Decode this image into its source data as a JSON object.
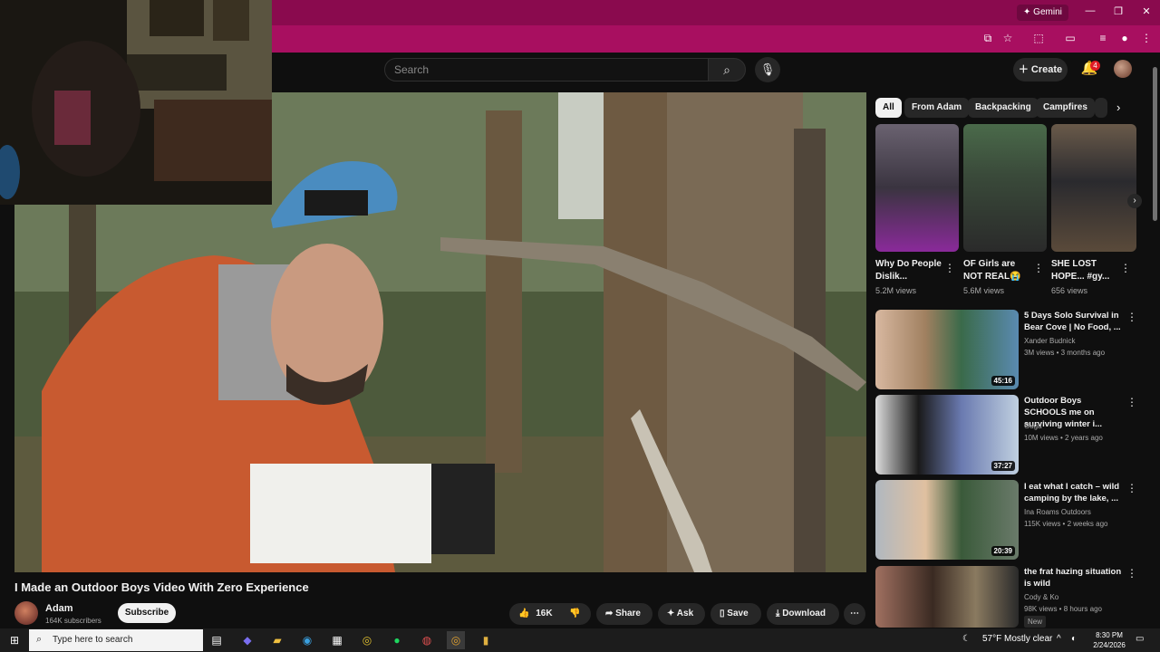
{
  "browser": {
    "gemini_label": "Gemini",
    "win_controls": [
      "—",
      "❐",
      "✕"
    ]
  },
  "youtube": {
    "search_placeholder": "Search",
    "create_label": "Create",
    "notification_count": "4"
  },
  "video": {
    "title": "I Made an Outdoor Boys Video With Zero Experience",
    "channel": "Adam",
    "subscribers": "164K subscribers",
    "subscribe_label": "Subscribe",
    "like_count": "16K",
    "share_label": "Share",
    "ask_label": "Ask",
    "save_label": "Save",
    "download_label": "Download"
  },
  "chips": [
    "All",
    "From Adam",
    "Backpacking",
    "Campfires"
  ],
  "shorts": [
    {
      "title": "Why Do People Dislik...",
      "views": "5.2M views"
    },
    {
      "title": "OF Girls are NOT REAL😭",
      "views": "5.6M views"
    },
    {
      "title": "SHE LOST HOPE... #gy...",
      "views": "656 views"
    }
  ],
  "recommended": [
    {
      "title": "5 Days Solo Survival in Bear Cove | No Food, ...",
      "channel": "Xander Budnick",
      "stats": "3M views • 3 months ago",
      "duration": "45:16",
      "badge": ""
    },
    {
      "title": "Outdoor Boys SCHOOLS me on surviving winter i...",
      "channel": "Guga",
      "stats": "10M views • 2 years ago",
      "duration": "37:27",
      "badge": ""
    },
    {
      "title": "I eat what I catch – wild camping by the lake, ...",
      "channel": "Ina Roams Outdoors",
      "stats": "115K views • 2 weeks ago",
      "duration": "20:39",
      "badge": ""
    },
    {
      "title": "the frat hazing situation is wild",
      "channel": "Cody & Ko",
      "stats": "98K views • 8 hours ago",
      "duration": "",
      "badge": "New"
    }
  ],
  "taskbar": {
    "search_placeholder": "Type here to search",
    "weather": "57°F  Mostly clear",
    "time": "8:30 PM",
    "date": "2/24/2026"
  },
  "colors": {
    "chrome_titlebar": "#8a0a4e",
    "chrome_toolbar": "#a80f60",
    "yt_bg": "#0f0f0f"
  }
}
